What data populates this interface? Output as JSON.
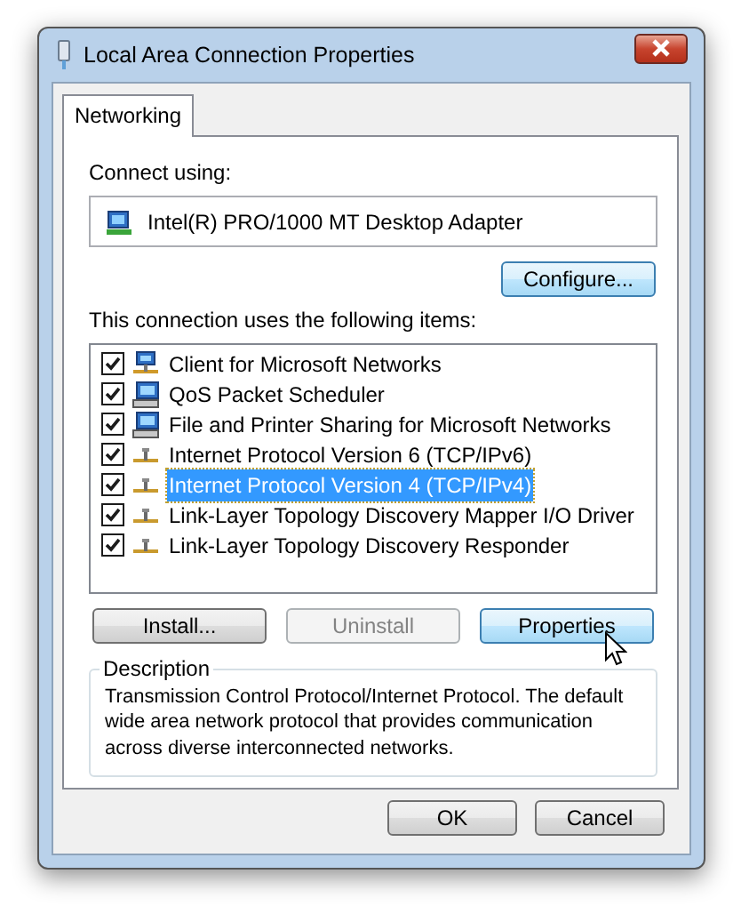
{
  "window": {
    "title": "Local Area Connection Properties"
  },
  "tabs": [
    {
      "label": "Networking",
      "selected": true
    }
  ],
  "connect_using": {
    "label": "Connect using:",
    "adapter": "Intel(R) PRO/1000 MT Desktop Adapter",
    "configure_button": "Configure..."
  },
  "items_label": "This connection uses the following items:",
  "items": [
    {
      "label": "Client for Microsoft Networks",
      "kind": "client",
      "checked": true,
      "selected": false
    },
    {
      "label": "QoS Packet Scheduler",
      "kind": "service",
      "checked": true,
      "selected": false
    },
    {
      "label": "File and Printer Sharing for Microsoft Networks",
      "kind": "service",
      "checked": true,
      "selected": false
    },
    {
      "label": "Internet Protocol Version 6 (TCP/IPv6)",
      "kind": "protocol",
      "checked": true,
      "selected": false
    },
    {
      "label": "Internet Protocol Version 4 (TCP/IPv4)",
      "kind": "protocol",
      "checked": true,
      "selected": true
    },
    {
      "label": "Link-Layer Topology Discovery Mapper I/O Driver",
      "kind": "protocol",
      "checked": true,
      "selected": false
    },
    {
      "label": "Link-Layer Topology Discovery Responder",
      "kind": "protocol",
      "checked": true,
      "selected": false
    }
  ],
  "item_buttons": [
    {
      "label": "Install...",
      "disabled": false,
      "hovered": false
    },
    {
      "label": "Uninstall",
      "disabled": true,
      "hovered": false
    },
    {
      "label": "Properties",
      "disabled": false,
      "hovered": true
    }
  ],
  "description": {
    "title": "Description",
    "text": "Transmission Control Protocol/Internet Protocol. The default wide area network protocol that provides communication across diverse interconnected networks."
  },
  "dialog_buttons": [
    "OK",
    "Cancel"
  ]
}
